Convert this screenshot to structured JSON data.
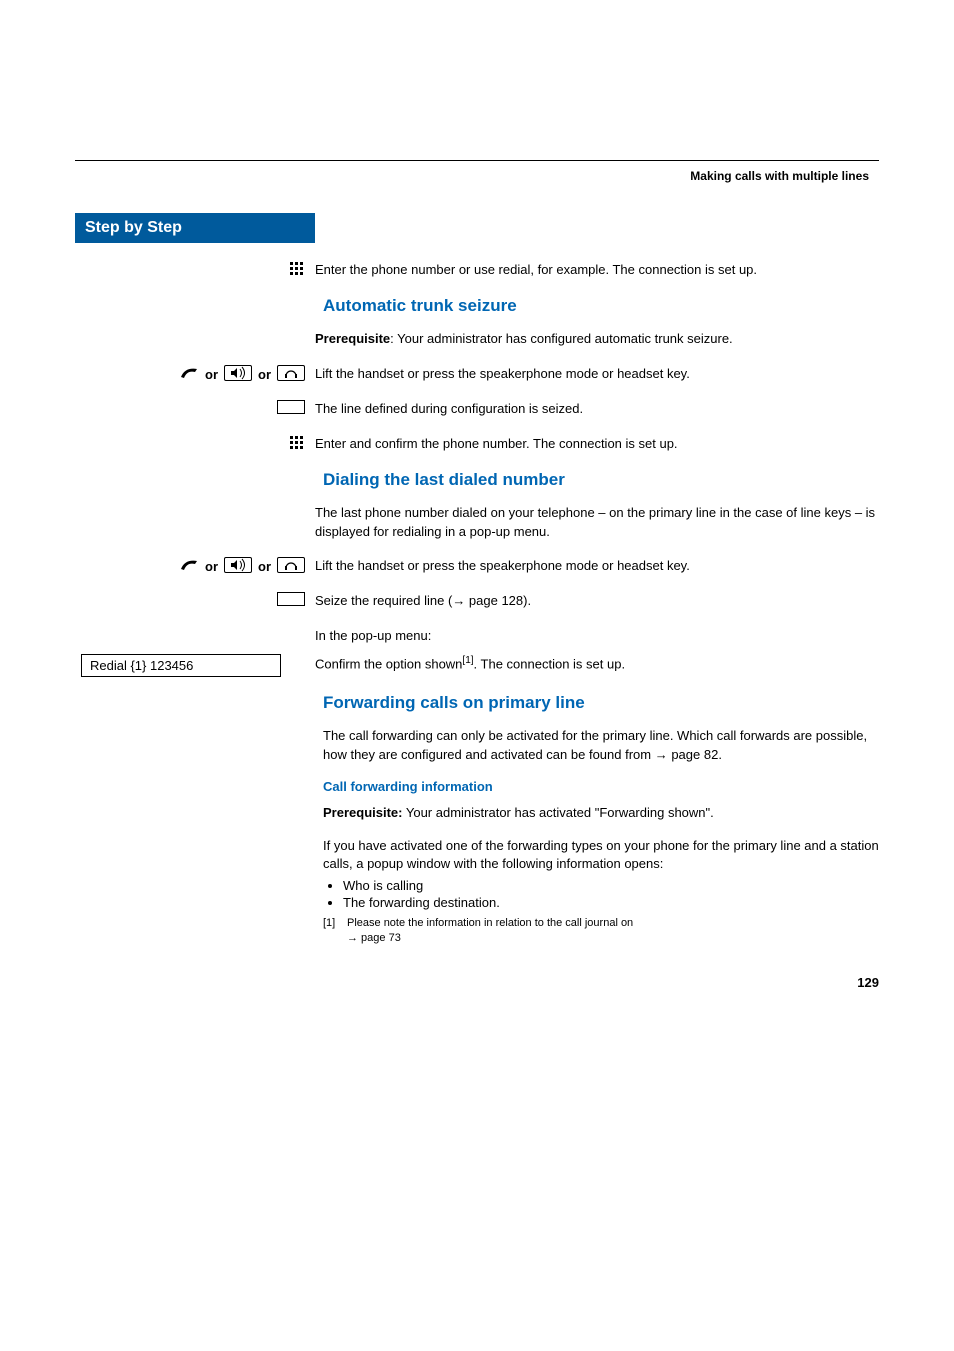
{
  "header": {
    "title": "Making calls with multiple lines"
  },
  "sidebar": {
    "step_by_step": "Step by Step"
  },
  "body": {
    "intro": "Enter the phone number or use redial, for example. The connection is set up.",
    "section1": {
      "title": "Automatic trunk seizure",
      "prereq_label": "Prerequisite",
      "prereq_text": ": Your administrator has configured automatic trunk seizure.",
      "or_label": "or",
      "lift1": "Lift the handset or press the speakerphone mode or headset key.",
      "line_defined": "The line defined during configuration is seized.",
      "enter_confirm": "Enter and confirm the phone number. The connection is set up."
    },
    "section2": {
      "title": "Dialing the last dialed number",
      "p1": "The last phone number dialed on your telephone – on the primary line in the case of line keys – is displayed for redialing in a pop-up menu.",
      "or_label": "or",
      "lift2": "Lift the handset or press the speakerphone mode or headset key.",
      "seize": "Seize the required line (",
      "seize_ref": " page 128).",
      "popup": "In the pop-up menu:",
      "redial_option": "Redial {1} 123456",
      "confirm": "Confirm the option shown",
      "confirm_sup": "[1]",
      "confirm_tail": ". The connection is set up."
    },
    "section3": {
      "title": "Forwarding calls on primary line",
      "p1_a": "The call forwarding can only be activated for the primary line. Which call forwards are possible, how they are configured and activated can be found from ",
      "p1_ref": " page 82.",
      "subhead": "Call forwarding information",
      "prereq_label": "Prerequisite:",
      "prereq_text": " Your administrator has activated \"Forwarding shown\".",
      "p3": "If you have activated one of the forwarding types on your phone for the primary line and a station calls, a popup window with the following information opens:",
      "bullets": [
        "Who is calling",
        "The forwarding destination."
      ]
    },
    "footnote": {
      "num": "[1]",
      "text_a": "Please note the information in relation to the call journal on ",
      "ref": " page 73"
    },
    "page_number": "129",
    "arrow": "→"
  }
}
